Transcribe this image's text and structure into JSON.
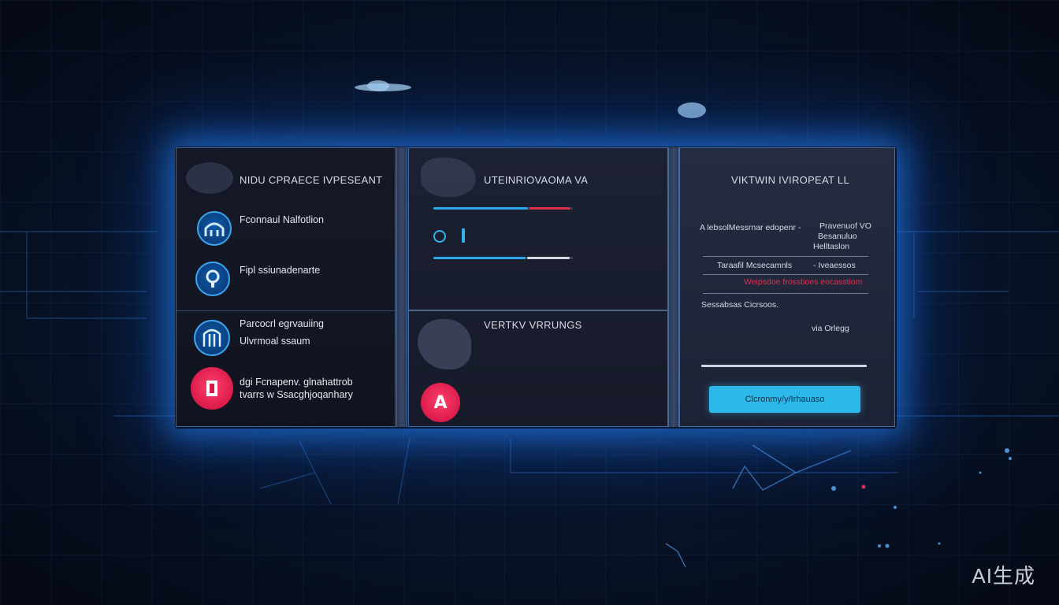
{
  "left_panel": {
    "title": "NIDU CPRAECE IVPESEANT",
    "items": [
      {
        "line1": "Fconnaul Nalfotlion",
        "line2": "",
        "icon": "arch-icon",
        "accent": "#1e6fc8"
      },
      {
        "line1": "Fipl ssiunadenarte",
        "line2": "",
        "icon": "lock-icon",
        "accent": "#1e6fc8"
      },
      {
        "line1": "Parcocrl egrvauiing",
        "line2": "Ulvrmoal ssaum",
        "icon": "columns-icon",
        "accent": "#1e6fc8"
      },
      {
        "line1": "dgi Fcnapenv. glnahattrob",
        "line2": "tvarrs w Ssacghjoqanhary",
        "icon": "document-icon",
        "accent": "#e01b4d"
      }
    ]
  },
  "middle_panel": {
    "title": "UTEINRIOVAOMA VA",
    "bar1": {
      "fill": 0.68,
      "color": "#2aa8ea",
      "tail_color": "#e0314f"
    },
    "bar2": {
      "fill": 0.66,
      "color": "#2aa8ea",
      "tail_color": "#d8d8e0"
    },
    "section2_title": "VERTKV VRRUNGS",
    "badge_icon": "a-letter-icon",
    "badge_letter": "A",
    "badge_color": "#e01b4d"
  },
  "right_panel": {
    "title": "VIKTWIN IVIROPEAT LL",
    "row1_left": "A lebsolMessrnar edopenr -",
    "row1_right": [
      "Pravenuof VO",
      "Besanuluo",
      "Helltaslon"
    ],
    "row2_left": "Taraafil Mcsecamnls",
    "row2_right": "- Iveaessos",
    "row3_alert": "Weipsdoe frosstioes eocasstiom",
    "row3_color": "#e0314f",
    "row4_left": "Sessabsas Cicrsoos.",
    "row4_right": "via Orlegg",
    "button_label": "Clcronmy/y/Irhauaso",
    "button_color": "#2db8ea"
  },
  "watermark": "AI生成"
}
